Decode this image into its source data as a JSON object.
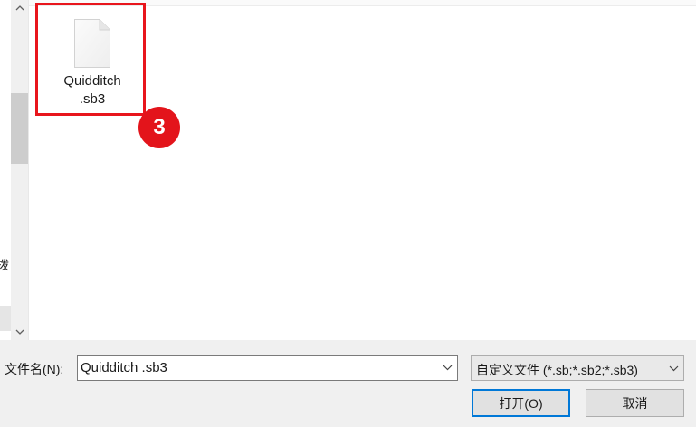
{
  "nav": {
    "partial_label": "拨"
  },
  "files": [
    {
      "name_line1": "Quidditch",
      "name_line2": ".sb3",
      "icon": "blank-document-icon"
    }
  ],
  "annotation": {
    "step_number": "3",
    "color": "#e3141b"
  },
  "filename": {
    "label": "文件名(N):",
    "value": "Quidditch .sb3"
  },
  "filetype": {
    "selected": "自定义文件 (*.sb;*.sb2;*.sb3)"
  },
  "buttons": {
    "open": "打开(O)",
    "cancel": "取消"
  },
  "colors": {
    "accent": "#0078d7",
    "highlight": "#e8151c"
  }
}
